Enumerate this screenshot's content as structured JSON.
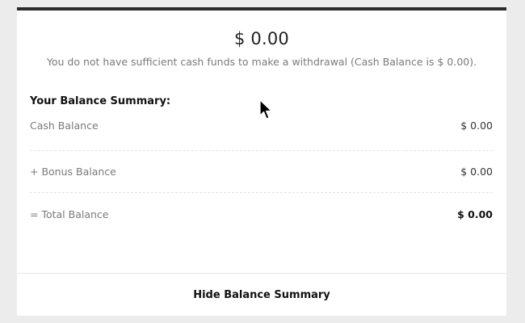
{
  "balance": {
    "amount": "$ 0.00",
    "notice": "You do not have sufficient cash funds to make a withdrawal (Cash Balance is $ 0.00)."
  },
  "summary": {
    "title": "Your Balance Summary:",
    "rows": [
      {
        "label": "Cash Balance",
        "value": "$ 0.00"
      },
      {
        "label": "+ Bonus Balance",
        "value": "$ 0.00"
      },
      {
        "label": "= Total Balance",
        "value": "$ 0.00"
      }
    ]
  },
  "footer": {
    "hide_label": "Hide Balance Summary"
  },
  "cursor": {
    "icon": "mouse-pointer-icon"
  }
}
